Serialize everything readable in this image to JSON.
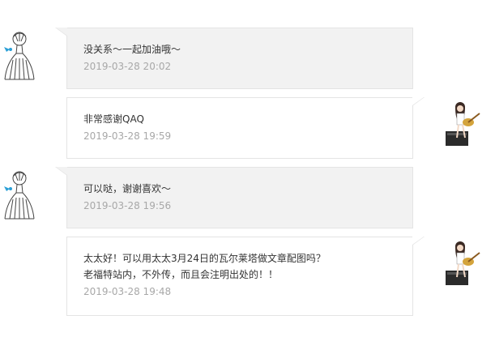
{
  "messages": [
    {
      "side": "left",
      "avatar": "sketch-girl-avatar",
      "lines": [
        "没关系～一起加油哦～"
      ],
      "time": "2019-03-28 20:02"
    },
    {
      "side": "right",
      "avatar": "guitar-girl-avatar",
      "lines": [
        "非常感谢QAQ"
      ],
      "time": "2019-03-28 19:59"
    },
    {
      "side": "left",
      "avatar": "sketch-girl-avatar",
      "lines": [
        "可以哒，谢谢喜欢～"
      ],
      "time": "2019-03-28 19:56"
    },
    {
      "side": "right",
      "avatar": "guitar-girl-avatar",
      "lines": [
        "太太好！可以用太太3月24日的瓦尔莱塔做文章配图吗？",
        "老福特站内，不外传，而且会注明出处的！！"
      ],
      "time": "2019-03-28 19:48"
    }
  ],
  "colors": {
    "left_bubble_bg": "#f2f2f2",
    "right_bubble_bg": "#ffffff",
    "border": "#e4e4e4",
    "text": "#333333",
    "timestamp": "#a8a8a8"
  }
}
